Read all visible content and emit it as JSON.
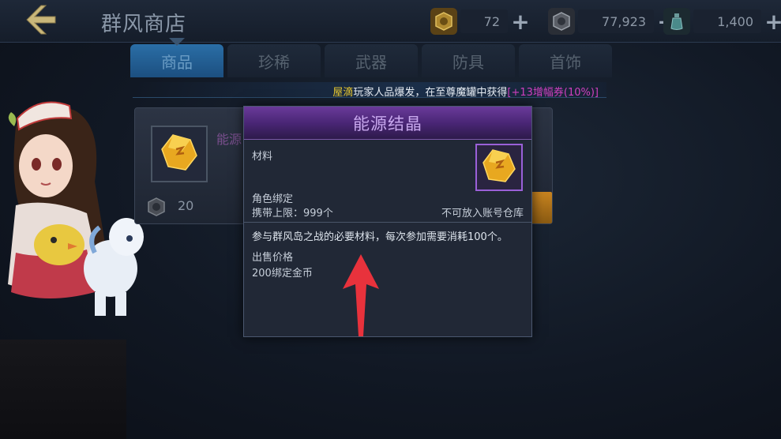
{
  "header": {
    "title": "群风商店",
    "back_icon": "back-arrow-icon"
  },
  "currencies": [
    {
      "icon": "bound-gold-icon",
      "value": "72"
    },
    {
      "icon": "gold-coin-icon",
      "value": "77,923"
    },
    {
      "icon": "potion-bottle-icon",
      "value": "1,400"
    }
  ],
  "plus_label": "+",
  "tabs": [
    "商品",
    "珍稀",
    "武器",
    "防具",
    "首饰"
  ],
  "active_tab": "商品",
  "announcement": {
    "player": "屋滴",
    "body": "玩家人品爆发，在至尊魔罐中获得",
    "item": "[+13增幅券(10%)]"
  },
  "card": {
    "name": "能源",
    "price": "20"
  },
  "tooltip": {
    "title": "能源结晶",
    "category": "材料",
    "binding": "角色绑定",
    "carry_limit": "携带上限：999个",
    "storage_note": "不可放入账号仓库",
    "description": "参与群风岛之战的必要材料，每次参加需要消耗100个。",
    "sell_label": "出售价格",
    "sell_value": "200绑定金币"
  },
  "colors": {
    "active_tab": "#2a6ea6",
    "tooltip_header": "#4a2676",
    "announce_name": "#e8c830",
    "announce_item": "#d040c0",
    "arrow": "#e8323c"
  }
}
